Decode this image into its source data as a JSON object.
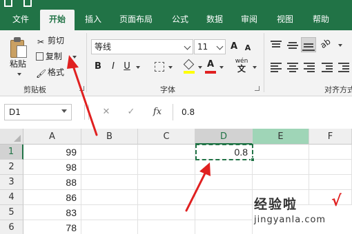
{
  "ribbon": {
    "tabs": [
      {
        "label": "文件",
        "active": false
      },
      {
        "label": "开始",
        "active": true
      },
      {
        "label": "插入",
        "active": false
      },
      {
        "label": "页面布局",
        "active": false
      },
      {
        "label": "公式",
        "active": false
      },
      {
        "label": "数据",
        "active": false
      },
      {
        "label": "审阅",
        "active": false
      },
      {
        "label": "视图",
        "active": false
      },
      {
        "label": "帮助",
        "active": false
      }
    ],
    "clipboard": {
      "paste_label": "粘贴",
      "cut_label": "剪切",
      "copy_label": "复制",
      "format_painter_label": "格式",
      "group_label": "剪贴板"
    },
    "font": {
      "font_name": "等线",
      "font_size": "11",
      "grow_label": "A",
      "shrink_label": "A",
      "bold_label": "B",
      "italic_label": "I",
      "underline_label": "U",
      "font_color_label": "A",
      "phonetic_label": "wén",
      "group_label": "字体",
      "fill_color": "#ffff00",
      "font_color": "#e02020"
    },
    "alignment": {
      "group_label": "对齐方式"
    }
  },
  "formula_bar": {
    "name_box": "D1",
    "cancel_icon": "✕",
    "enter_icon": "✓",
    "fx_label": "fx",
    "value": "0.8"
  },
  "grid": {
    "columns": [
      "A",
      "B",
      "C",
      "D",
      "E",
      "F"
    ],
    "selected_column": "D",
    "highlighted_column": "E",
    "rows": [
      {
        "num": "1",
        "A": "99",
        "D": "0.8"
      },
      {
        "num": "2",
        "A": "98"
      },
      {
        "num": "3",
        "A": "88"
      },
      {
        "num": "4",
        "A": "86"
      },
      {
        "num": "5",
        "A": "83"
      },
      {
        "num": "6",
        "A": "78"
      }
    ]
  },
  "watermark": {
    "title": "经验啦",
    "check": "√",
    "url": "jingyanla.com"
  },
  "colors": {
    "accent": "#217346",
    "arrow": "#e02020"
  }
}
